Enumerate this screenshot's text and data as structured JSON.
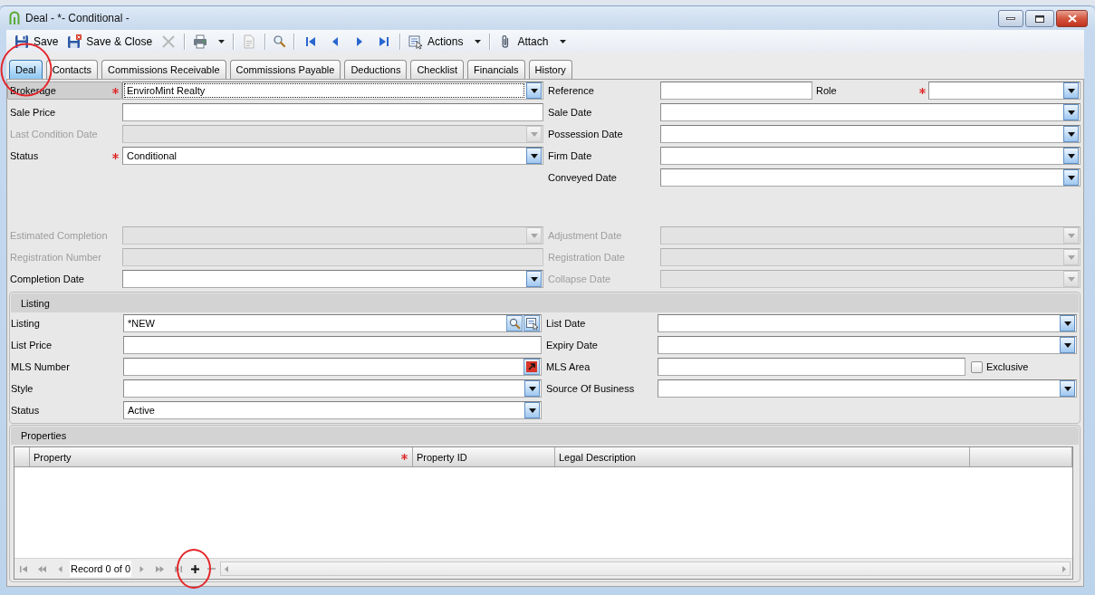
{
  "window": {
    "title": "Deal - *- Conditional -"
  },
  "toolbar": [
    [
      {
        "kind": "save",
        "label": "Save",
        "menu": false,
        "disabled": false
      },
      {
        "kind": "save_close",
        "label": "Save & Close",
        "menu": false,
        "disabled": false
      },
      {
        "kind": "delete",
        "menu": false,
        "disabled": true
      }
    ],
    [
      {
        "kind": "print",
        "menu": true,
        "disabled": false
      }
    ],
    [
      {
        "kind": "document",
        "menu": false,
        "disabled": true
      }
    ],
    [
      {
        "kind": "find",
        "menu": false,
        "disabled": false
      }
    ],
    [
      {
        "kind": "first",
        "menu": false,
        "disabled": false
      },
      {
        "kind": "previous",
        "menu": false,
        "disabled": false
      },
      {
        "kind": "next",
        "menu": false,
        "disabled": false
      },
      {
        "kind": "last",
        "menu": false,
        "disabled": false
      }
    ],
    [
      {
        "kind": "actions",
        "label": "Actions",
        "menu": true,
        "disabled": false
      }
    ],
    [
      {
        "kind": "attach",
        "label": "Attach",
        "menu": true,
        "disabled": false
      }
    ]
  ],
  "tabs": [
    {
      "label": "Deal",
      "selected": true,
      "circled": true
    },
    {
      "label": "Contacts",
      "selected": false,
      "circled": false
    },
    {
      "label": "Commissions Receivable",
      "selected": false,
      "circled": false
    },
    {
      "label": "Commissions Payable",
      "selected": false,
      "circled": false
    },
    {
      "label": "Deductions",
      "selected": false,
      "circled": false
    },
    {
      "label": "Checklist",
      "selected": false,
      "circled": false
    },
    {
      "label": "Financials",
      "selected": false,
      "circled": false
    },
    {
      "label": "History",
      "selected": false,
      "circled": false
    }
  ],
  "deal_form": {
    "upper_rows": [
      {
        "left": {
          "label": "Brokerage",
          "kind": "combo",
          "required": true,
          "disabled": false,
          "focused": true,
          "value": "EnviroMint Realty"
        },
        "right": {
          "label": "Reference",
          "kind": "text",
          "required": false,
          "disabled": false,
          "focused": false,
          "companion": {
            "label": "Role",
            "kind": "combo",
            "required": true,
            "disabled": false,
            "focused": false
          }
        }
      },
      {
        "left": {
          "label": "Sale Price",
          "kind": "text",
          "required": false,
          "disabled": false,
          "focused": false
        },
        "right": {
          "label": "Sale Date",
          "kind": "combo",
          "required": false,
          "disabled": false,
          "focused": false
        }
      },
      {
        "left": {
          "label": "Last Condition Date",
          "kind": "combo",
          "required": false,
          "disabled": true,
          "focused": false
        },
        "right": {
          "label": "Possession Date",
          "kind": "combo",
          "required": false,
          "disabled": false,
          "focused": false
        }
      },
      {
        "left": {
          "label": "Status",
          "kind": "combo",
          "required": true,
          "disabled": false,
          "focused": false,
          "value": "Conditional"
        },
        "right": {
          "label": "Firm Date",
          "kind": "combo",
          "required": false,
          "disabled": false,
          "focused": false
        }
      },
      {
        "right": {
          "label": "Conveyed Date",
          "kind": "combo",
          "required": false,
          "disabled": false,
          "focused": false
        }
      }
    ],
    "lower_rows": [
      {
        "left": {
          "label": "Estimated Completion",
          "kind": "combo",
          "required": false,
          "disabled": true,
          "focused": false
        },
        "right": {
          "label": "Adjustment Date",
          "kind": "combo",
          "required": false,
          "disabled": true,
          "focused": false
        }
      },
      {
        "left": {
          "label": "Registration Number",
          "kind": "text",
          "required": false,
          "disabled": true,
          "focused": false
        },
        "right": {
          "label": "Registration Date",
          "kind": "combo",
          "required": false,
          "disabled": true,
          "focused": false
        }
      },
      {
        "left": {
          "label": "Completion Date",
          "kind": "combo",
          "required": false,
          "disabled": false,
          "focused": false
        },
        "right": {
          "label": "Collapse Date",
          "kind": "combo",
          "required": false,
          "disabled": true,
          "focused": false
        }
      }
    ]
  },
  "listing": {
    "title": "Listing",
    "rows": [
      {
        "left": {
          "label": "Listing",
          "kind": "lookup",
          "required": false,
          "disabled": false,
          "focused": false,
          "value": "*NEW"
        },
        "right": {
          "label": "List Date",
          "kind": "combo",
          "required": false,
          "disabled": false,
          "focused": false
        }
      },
      {
        "left": {
          "label": "List Price",
          "kind": "text",
          "required": false,
          "disabled": false,
          "focused": false
        },
        "right": {
          "label": "Expiry Date",
          "kind": "combo",
          "required": false,
          "disabled": false,
          "focused": false
        }
      },
      {
        "left": {
          "label": "MLS Number",
          "kind": "link",
          "required": false,
          "disabled": false,
          "focused": false
        },
        "right": {
          "label": "MLS Area",
          "kind": "text",
          "required": false,
          "disabled": false,
          "focused": false,
          "companion": {
            "label": "Exclusive",
            "kind": "checkbox",
            "checked": false
          }
        }
      },
      {
        "left": {
          "label": "Style",
          "kind": "combo",
          "required": false,
          "disabled": false,
          "focused": false
        },
        "right": {
          "label": "Source Of Business",
          "kind": "combo",
          "required": false,
          "disabled": false,
          "focused": false
        }
      },
      {
        "left": {
          "label": "Status",
          "kind": "combo",
          "required": false,
          "disabled": false,
          "focused": false,
          "value": "Active"
        }
      }
    ]
  },
  "properties": {
    "title": "Properties",
    "columns": [
      {
        "label": "Property",
        "required": true
      },
      {
        "label": "Property ID",
        "required": false
      },
      {
        "label": "Legal Description",
        "required": false
      }
    ],
    "pager": {
      "record_text": "Record 0 of 0",
      "navigation": {
        "disabled": true
      },
      "add": {
        "disabled": false,
        "circled": true
      },
      "remove": {
        "disabled": true
      }
    }
  }
}
